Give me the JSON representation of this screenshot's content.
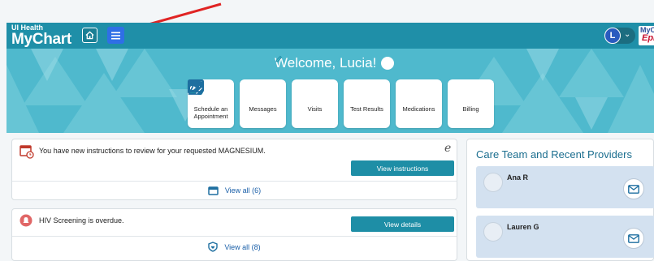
{
  "header": {
    "brand_sub": "UI Health",
    "brand_main": "MyChart",
    "home_icon": "home-icon",
    "menu_icon": "hamburger-menu-icon",
    "user_initial": "L",
    "epic_logo_top": "MyCh",
    "epic_logo_bottom": "Epi",
    "colors": {
      "bar": "#1f8fa8",
      "menu_button": "#2f6fe6",
      "annotation_arrow": "#e02424"
    }
  },
  "hero": {
    "welcome": "Welcome, Lucia!",
    "tiles": [
      {
        "label": "Schedule an Appointment",
        "icon": "calendar-plus-icon"
      },
      {
        "label": "Messages",
        "icon": "envelope-icon"
      },
      {
        "label": "Visits",
        "icon": "calendar-icon"
      },
      {
        "label": "Test Results",
        "icon": "flask-icon"
      },
      {
        "label": "Medications",
        "icon": "pills-icon"
      },
      {
        "label": "Billing",
        "icon": "credit-card-icon"
      }
    ]
  },
  "cards": [
    {
      "message": "You have new instructions to review for your requested MAGNESIUM.",
      "button": "View instructions",
      "view_all": "View all (6)"
    },
    {
      "message": "HIV Screening is overdue.",
      "button": "View details",
      "view_all": "View all (8)"
    }
  ],
  "care_team": {
    "title": "Care Team and Recent Providers",
    "providers": [
      {
        "name": "Ana R"
      },
      {
        "name": "Lauren G"
      }
    ]
  }
}
